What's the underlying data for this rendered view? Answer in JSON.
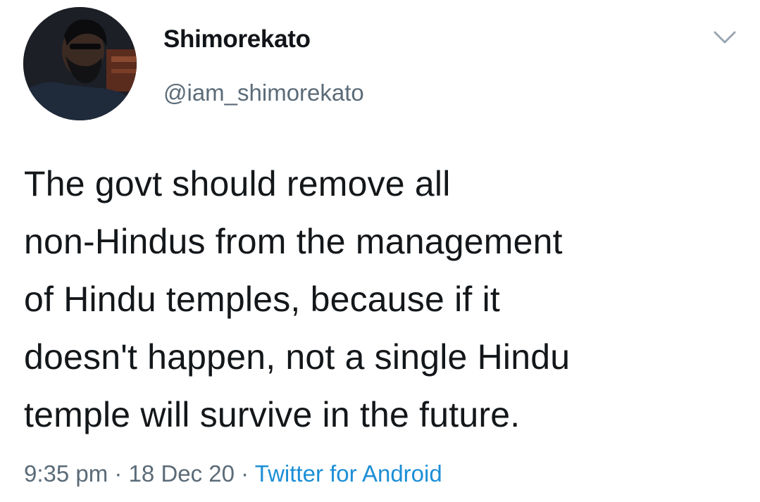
{
  "user": {
    "display_name": "Shimorekato",
    "handle": "@iam_shimorekato",
    "avatar_icon": "profile-photo"
  },
  "menu": {
    "icon": "chevron-down-icon"
  },
  "tweet": {
    "lines": [
      "The govt should remove all",
      "non-Hindus from the management",
      "of Hindu temples, because if it",
      "doesn't happen, not a single Hindu",
      "temple will survive in the future."
    ]
  },
  "meta": {
    "time": "9:35 pm",
    "separator": " · ",
    "date": "18 Dec 20",
    "source": "Twitter for Android"
  },
  "colors": {
    "text": "#14171a",
    "secondary": "#5b6b78",
    "link": "#1d8fd6"
  }
}
